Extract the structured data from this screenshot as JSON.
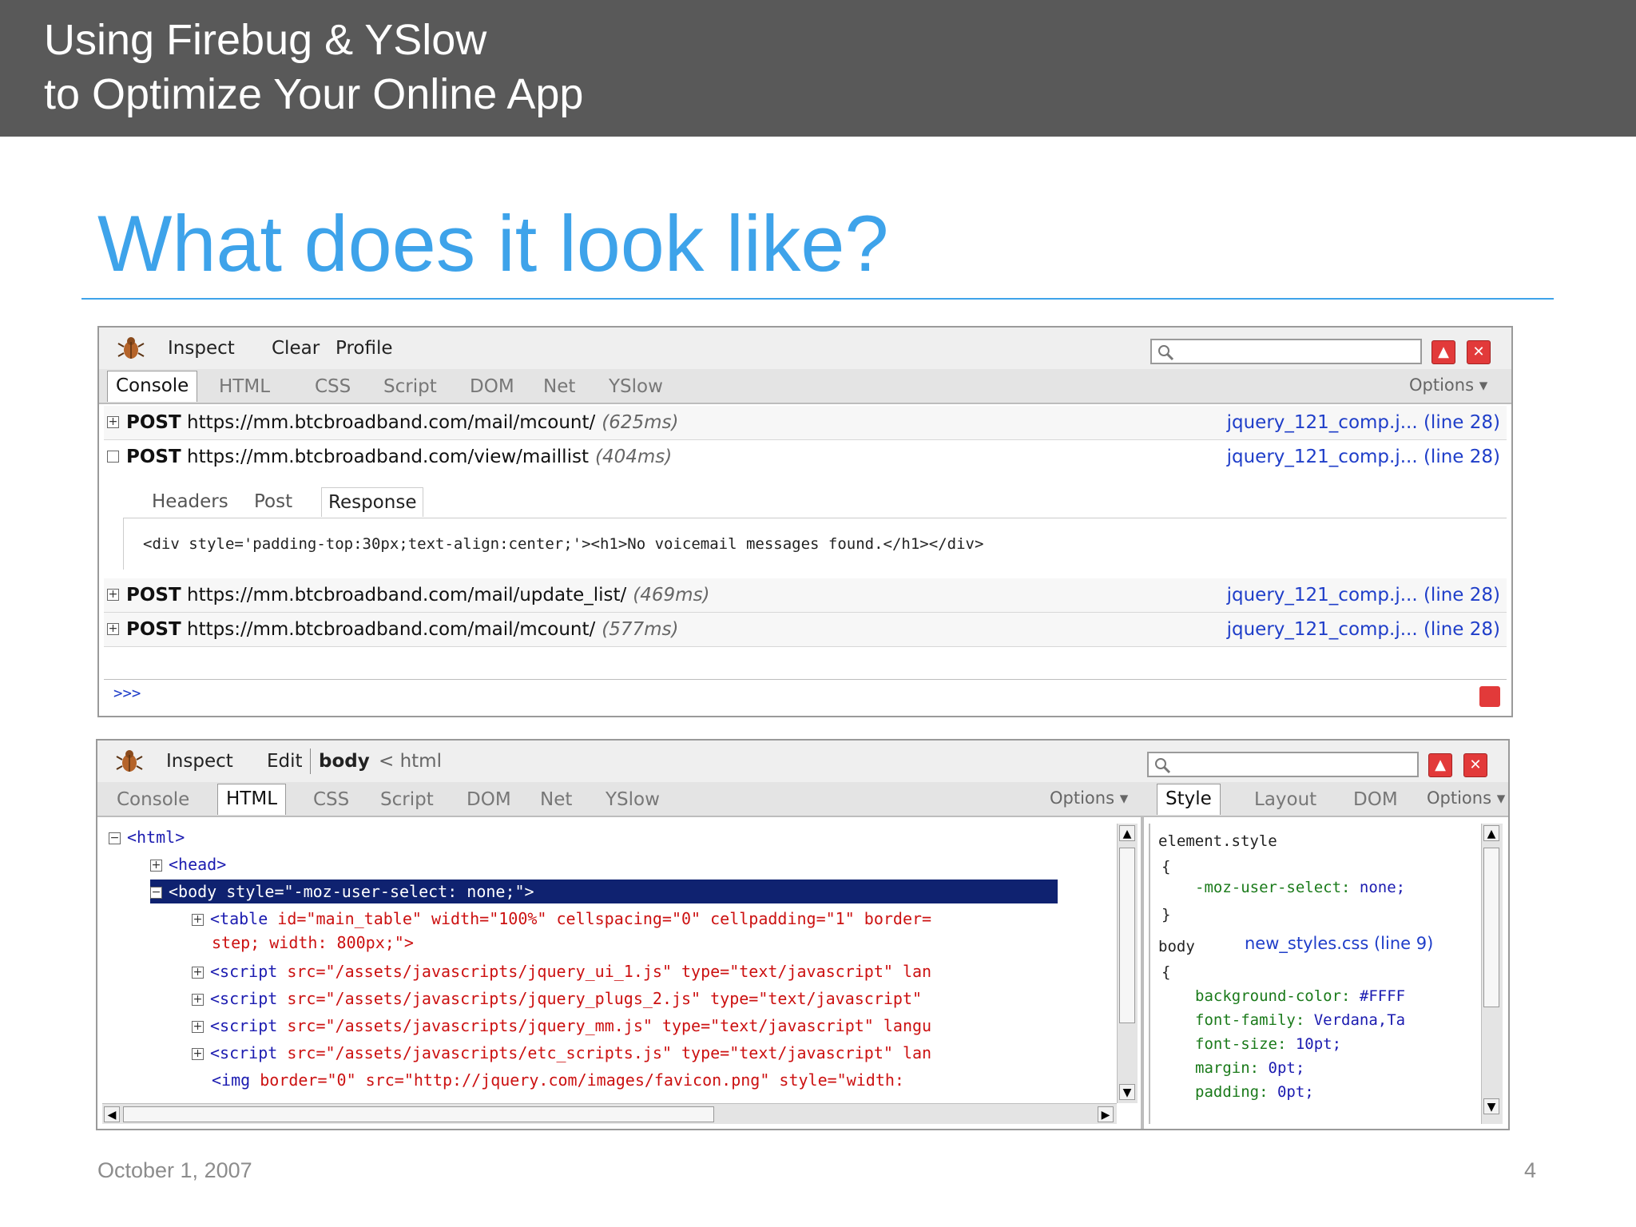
{
  "header": {
    "title_line1": "Using Firebug & YSlow",
    "title_line2": "to Optimize Your Online App"
  },
  "slide": {
    "title": "What does it look like?",
    "date": "October 1, 2007",
    "page_number": "4"
  },
  "panel1": {
    "toolbar": {
      "inspect": "Inspect",
      "clear": "Clear",
      "profile": "Profile"
    },
    "tabs": [
      "Console",
      "HTML",
      "CSS",
      "Script",
      "DOM",
      "Net",
      "YSlow"
    ],
    "active_tab": "Console",
    "options": "Options ▾",
    "requests": [
      {
        "method": "POST",
        "url": "https://mm.btcbroadband.com/mail/mcount/",
        "time": "(625ms)",
        "source": "jquery_121_comp.j... (line 28)",
        "expanded": false
      },
      {
        "method": "POST",
        "url": "https://mm.btcbroadband.com/view/maillist",
        "time": "(404ms)",
        "source": "jquery_121_comp.j... (line 28)",
        "expanded": true
      },
      {
        "method": "POST",
        "url": "https://mm.btcbroadband.com/mail/update_list/",
        "time": "(469ms)",
        "source": "jquery_121_comp.j... (line 28)",
        "expanded": false
      },
      {
        "method": "POST",
        "url": "https://mm.btcbroadband.com/mail/mcount/",
        "time": "(577ms)",
        "source": "jquery_121_comp.j... (line 28)",
        "expanded": false
      }
    ],
    "sub_tabs": [
      "Headers",
      "Post",
      "Response"
    ],
    "response": "<div style='padding-top:30px;text-align:center;'><h1>No voicemail messages found.</h1></div>",
    "prompt": ">>>"
  },
  "panel2": {
    "toolbar": {
      "inspect": "Inspect",
      "edit": "Edit",
      "crumb_active": "body",
      "crumb_parent": "< html"
    },
    "tabs": [
      "Console",
      "HTML",
      "CSS",
      "Script",
      "DOM",
      "Net",
      "YSlow"
    ],
    "active_tab": "HTML",
    "options": "Options ▾",
    "right_tabs": [
      "Style",
      "Layout",
      "DOM"
    ],
    "right_active": "Style",
    "right_options": "Options ▾",
    "tree": [
      {
        "tag": "<html>",
        "attrs": "",
        "indent": 0
      },
      {
        "tag": "<head>",
        "attrs": "",
        "indent": 1
      },
      {
        "tag": "<body",
        "attrs": " style=\"-moz-user-select: none;\">",
        "indent": 1
      },
      {
        "tag": "<table",
        "attrs": " id=\"main_table\" width=\"100%\" cellspacing=\"0\" cellpadding=\"1\" border=",
        "indent": 2
      },
      {
        "tag": "",
        "attrs": "step; width: 800px;\">",
        "indent": 2
      },
      {
        "tag": "<script",
        "attrs": " src=\"/assets/javascripts/jquery_ui_1.js\" type=\"text/javascript\" lan",
        "indent": 2
      },
      {
        "tag": "<script",
        "attrs": " src=\"/assets/javascripts/jquery_plugs_2.js\" type=\"text/javascript\"",
        "indent": 2
      },
      {
        "tag": "<script",
        "attrs": " src=\"/assets/javascripts/jquery_mm.js\" type=\"text/javascript\" langu",
        "indent": 2
      },
      {
        "tag": "<script",
        "attrs": " src=\"/assets/javascripts/etc_scripts.js\" type=\"text/javascript\" lan",
        "indent": 2
      },
      {
        "tag": "<img",
        "attrs": " border=\"0\" src=\"http://jquery.com/images/favicon.png\" style=\"width:",
        "indent": 2
      }
    ],
    "style": {
      "element_style": "element.style",
      "open_brace": "{",
      "close_brace": "}",
      "rule1_prop": "-moz-user-select:",
      "rule1_val": "none;",
      "body_selector": "body",
      "body_source": "new_styles.css (line 9)",
      "props": [
        {
          "p": "background-color:",
          "v": "#FFFF"
        },
        {
          "p": "font-family:",
          "v": "Verdana,Ta"
        },
        {
          "p": "font-size:",
          "v": "10pt;"
        },
        {
          "p": "margin:",
          "v": "0pt;"
        },
        {
          "p": "padding:",
          "v": "0pt;"
        }
      ]
    }
  },
  "icons": {
    "bug": "firebug-icon",
    "search": "search-icon",
    "close": "close-icon",
    "minimize": "minimize-icon"
  },
  "colors": {
    "header_bg": "#595959",
    "title_blue": "#3ea3ea",
    "link_blue": "#1f3ec9",
    "selection": "#0f2270",
    "attr_red": "#cc1111"
  }
}
